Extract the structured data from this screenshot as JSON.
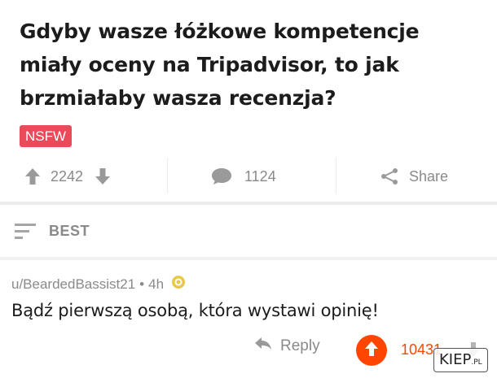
{
  "post": {
    "title": "Gdyby wasze łóżkowe kompetencje miały oceny na Tripadvisor, to jak brzmiałaby wasza recenzja?",
    "nsfw_label": "NSFW",
    "votes": "2242",
    "comments": "1124",
    "share_label": "Share"
  },
  "sort": {
    "label": "BEST"
  },
  "comment": {
    "author": "u/BeardedBassist21",
    "separator": "•",
    "age": "4h",
    "text": "Bądź pierwszą osobą, która wystawi opinię!",
    "reply_label": "Reply",
    "score": "10431"
  },
  "watermark": {
    "main": "KIEP",
    "suffix": ".PL"
  },
  "colors": {
    "upvote_active": "#ff4500",
    "nsfw": "#ea4a5a",
    "muted": "#8a8a8a"
  }
}
